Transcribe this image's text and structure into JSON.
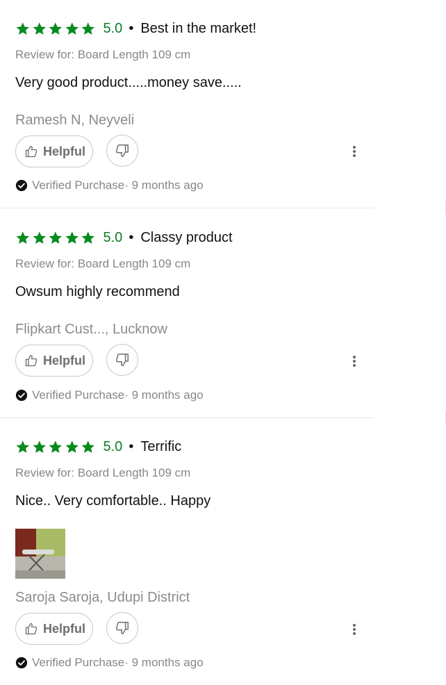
{
  "reviews": [
    {
      "rating": 5,
      "score": "5.0",
      "separator": "•",
      "title": "Best in the market!",
      "review_for": "Review for: Board Length 109 cm",
      "text": "Very good product.....money save.....",
      "author": "Ramesh N, Neyveli",
      "helpful_label": "Helpful",
      "verified_label": "Verified Purchase",
      "time": "· 9 months ago",
      "has_image": false
    },
    {
      "rating": 5,
      "score": "5.0",
      "separator": "•",
      "title": "Classy product",
      "review_for": "Review for: Board Length 109 cm",
      "text": "Owsum highly recommend",
      "author": "Flipkart Cust..., Lucknow",
      "helpful_label": "Helpful",
      "verified_label": "Verified Purchase",
      "time": "· 9 months ago",
      "has_image": false
    },
    {
      "rating": 5,
      "score": "5.0",
      "separator": "•",
      "title": "Terrific",
      "review_for": "Review for: Board Length 109 cm",
      "text": "Nice.. Very comfortable.. Happy",
      "author": "Saroja Saroja, Udupi District",
      "helpful_label": "Helpful",
      "verified_label": "Verified Purchase",
      "time": "· 9 months ago",
      "has_image": true,
      "image_icon": "ironing-board-photo"
    }
  ],
  "colors": {
    "star": "#0a8a1f",
    "score": "#0a7f22",
    "muted_text": "#878787",
    "border": "#c9c9c9"
  },
  "icons": {
    "star": "star-icon",
    "helpful": "thumbs-up-icon",
    "unhelpful": "thumbs-down-icon",
    "more": "more-vertical-icon",
    "verified": "check-circle-icon"
  }
}
